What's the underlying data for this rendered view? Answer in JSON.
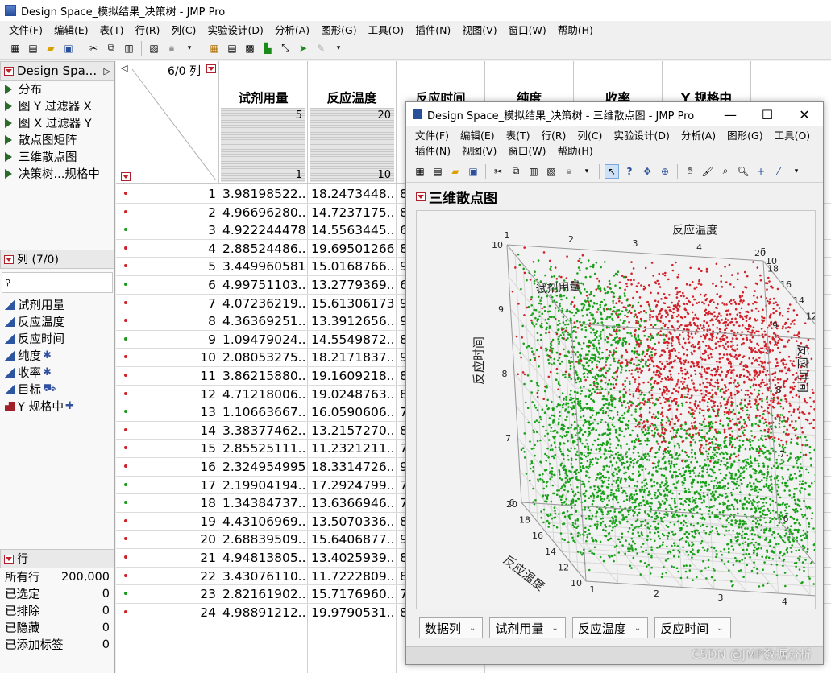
{
  "main": {
    "title": "Design Space_模拟结果_决策树 - JMP Pro",
    "menu": [
      "文件(F)",
      "编辑(E)",
      "表(T)",
      "行(R)",
      "列(C)",
      "实验设计(D)",
      "分析(A)",
      "图形(G)",
      "工具(O)",
      "插件(N)",
      "视图(V)",
      "窗口(W)",
      "帮助(H)"
    ]
  },
  "left": {
    "table_panel_title": "Design Spa...",
    "scripts": [
      "分布",
      "图 Y 过滤器 X",
      "图 X 过滤器 Y",
      "散点图矩阵",
      "三维散点图",
      "决策树...规格中"
    ],
    "columns_title": "列 (7/0)",
    "columns": [
      {
        "name": "试剂用量",
        "suffix": "",
        "kind": "cont"
      },
      {
        "name": "反应温度",
        "suffix": "",
        "kind": "cont"
      },
      {
        "name": "反应时间",
        "suffix": "",
        "kind": "cont"
      },
      {
        "name": "纯度",
        "suffix": "✱",
        "kind": "cont"
      },
      {
        "name": "收率",
        "suffix": "✱",
        "kind": "cont"
      },
      {
        "name": "目标",
        "suffix": "⛟",
        "kind": "cont"
      },
      {
        "name": "Y 规格中",
        "suffix": "✚",
        "kind": "nom"
      }
    ],
    "rows_title": "行",
    "rows": [
      {
        "label": "所有行",
        "value": "200,000"
      },
      {
        "label": "已选定",
        "value": "0"
      },
      {
        "label": "已排除",
        "value": "0"
      },
      {
        "label": "已隐藏",
        "value": "0"
      },
      {
        "label": "已添加标签",
        "value": "0"
      }
    ]
  },
  "table": {
    "corner_label": "6/0 列",
    "headers": [
      {
        "name": "试剂用量",
        "max": "5",
        "min": "1"
      },
      {
        "name": "反应温度",
        "max": "20",
        "min": "10"
      },
      {
        "name": "反应时间",
        "max": "",
        "min": ""
      },
      {
        "name": "纯度",
        "max": "",
        "min": ""
      },
      {
        "name": "收率",
        "max": "",
        "min": ""
      },
      {
        "name": "Y 规格中",
        "max": "",
        "min": ""
      }
    ],
    "rows": [
      {
        "n": "1",
        "a": "3.98198522...",
        "b": "18.2473448...",
        "c": "8",
        "color": "#d0202a"
      },
      {
        "n": "2",
        "a": "4.96696280...",
        "b": "14.7237175...",
        "c": "8",
        "color": "#d0202a"
      },
      {
        "n": "3",
        "a": "4.922244478",
        "b": "14.5563445...",
        "c": "6",
        "color": "#1a9a1a"
      },
      {
        "n": "4",
        "a": "2.88524486...",
        "b": "19.69501266",
        "c": "8",
        "color": "#d0202a"
      },
      {
        "n": "5",
        "a": "3.449960581",
        "b": "15.0168766...",
        "c": "9",
        "color": "#d0202a"
      },
      {
        "n": "6",
        "a": "4.99751103...",
        "b": "13.2779369...",
        "c": "6",
        "color": "#1a9a1a"
      },
      {
        "n": "7",
        "a": "4.07236219...",
        "b": "15.61306173",
        "c": "9",
        "color": "#d0202a"
      },
      {
        "n": "8",
        "a": "4.36369251...",
        "b": "13.3912656...",
        "c": "9",
        "color": "#d0202a"
      },
      {
        "n": "9",
        "a": "1.09479024...",
        "b": "14.5549872...",
        "c": "8",
        "color": "#1a9a1a"
      },
      {
        "n": "10",
        "a": "2.08053275...",
        "b": "18.2171837...",
        "c": "9",
        "color": "#d0202a"
      },
      {
        "n": "11",
        "a": "3.86215880...",
        "b": "19.1609218...",
        "c": "8",
        "color": "#d0202a"
      },
      {
        "n": "12",
        "a": "4.71218006...",
        "b": "19.0248763...",
        "c": "8",
        "color": "#d0202a"
      },
      {
        "n": "13",
        "a": "1.10663667...",
        "b": "16.0590606...",
        "c": "7",
        "color": "#1a9a1a"
      },
      {
        "n": "14",
        "a": "3.38377462...",
        "b": "13.2157270...",
        "c": "8",
        "color": "#d0202a"
      },
      {
        "n": "15",
        "a": "2.85525111...",
        "b": "11.2321211...",
        "c": "7",
        "color": "#d0202a"
      },
      {
        "n": "16",
        "a": "2.324954995",
        "b": "18.3314726...",
        "c": "9",
        "color": "#d0202a"
      },
      {
        "n": "17",
        "a": "2.19904194...",
        "b": "17.2924799...",
        "c": "7",
        "color": "#1a9a1a"
      },
      {
        "n": "18",
        "a": "1.34384737...",
        "b": "13.6366946...",
        "c": "7",
        "color": "#1a9a1a"
      },
      {
        "n": "19",
        "a": "4.43106969...",
        "b": "13.5070336...",
        "c": "8",
        "color": "#d0202a"
      },
      {
        "n": "20",
        "a": "2.68839509...",
        "b": "15.6406877...",
        "c": "9",
        "color": "#d0202a"
      },
      {
        "n": "21",
        "a": "4.94813805...",
        "b": "13.4025939...",
        "c": "8",
        "color": "#d0202a"
      },
      {
        "n": "22",
        "a": "3.43076110...",
        "b": "11.7222809...",
        "c": "8",
        "color": "#d0202a"
      },
      {
        "n": "23",
        "a": "2.82161902...",
        "b": "15.7176960...",
        "c": "7",
        "color": "#1a9a1a"
      },
      {
        "n": "24",
        "a": "4.98891212...",
        "b": "19.9790531...",
        "c": "8",
        "color": "#d0202a"
      }
    ]
  },
  "window": {
    "title": "Design Space_模拟结果_决策树 - 三维散点图 - JMP Pro",
    "menu": [
      "文件(F)",
      "编辑(E)",
      "表(T)",
      "行(R)",
      "列(C)",
      "实验设计(D)",
      "分析(A)",
      "图形(G)",
      "工具(O)",
      "插件(N)",
      "视图(V)",
      "窗口(W)",
      "帮助(H)"
    ],
    "report_title": "三维散点图",
    "buttons": [
      "数据列",
      "试剂用量",
      "反应温度",
      "反应时间"
    ],
    "watermark": "CSDN @JMP数据分析"
  },
  "chart_data": {
    "type": "scatter",
    "title": "",
    "x": {
      "label": "试剂用量",
      "range": [
        1,
        5
      ],
      "ticks": [
        1,
        2,
        3,
        4,
        5
      ]
    },
    "y": {
      "label": "反应温度",
      "range": [
        10,
        20
      ],
      "ticks": [
        10,
        12,
        14,
        16,
        18,
        20
      ]
    },
    "z": {
      "label": "反应时间",
      "range": [
        6,
        10
      ],
      "ticks": [
        6,
        7,
        8,
        9,
        10
      ]
    },
    "series": [
      {
        "name": "",
        "color": "#d0202a"
      },
      {
        "name": "",
        "color": "#1aa01a"
      }
    ],
    "grid": true
  }
}
